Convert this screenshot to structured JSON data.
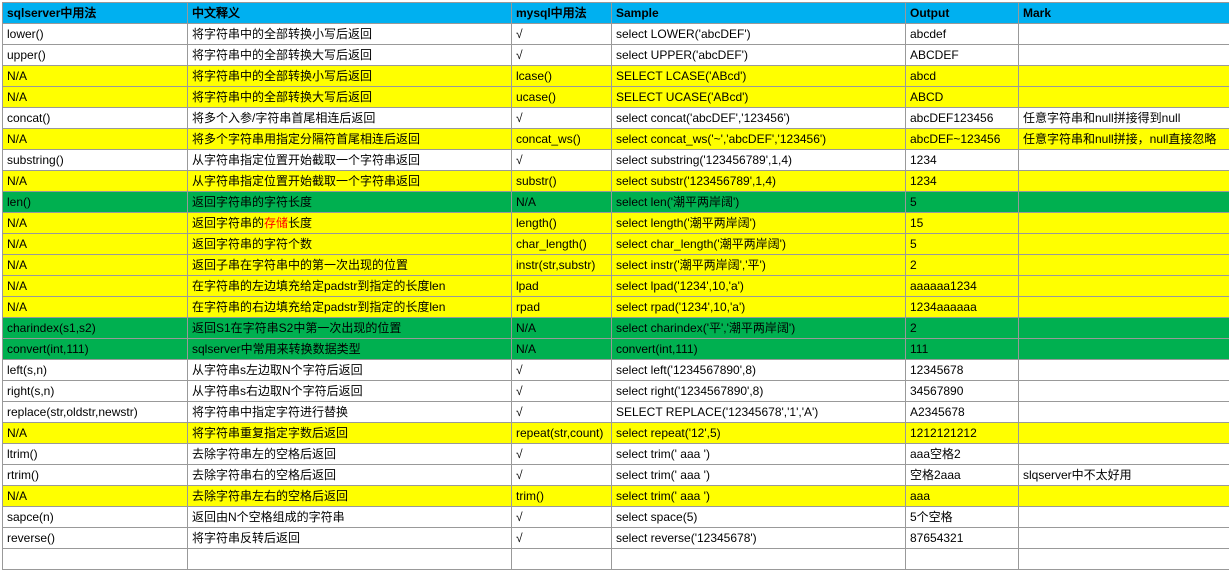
{
  "headers": [
    "sqlserver中用法",
    "中文释义",
    "mysql中用法",
    "Sample",
    "Output",
    "Mark"
  ],
  "rows": [
    {
      "c": "",
      "d": [
        "lower()",
        "将字符串中的全部转换小写后返回",
        "√",
        "select LOWER('abcDEF')",
        "abcdef",
        ""
      ]
    },
    {
      "c": "",
      "d": [
        "upper()",
        "将字符串中的全部转换大写后返回",
        "√",
        "select UPPER('abcDEF')",
        "ABCDEF",
        ""
      ]
    },
    {
      "c": "yellow",
      "d": [
        "N/A",
        "将字符串中的全部转换小写后返回",
        "lcase()",
        "SELECT LCASE('ABcd')",
        "abcd",
        ""
      ]
    },
    {
      "c": "yellow",
      "d": [
        "N/A",
        "将字符串中的全部转换大写后返回",
        "ucase()",
        "SELECT UCASE('ABcd')",
        "ABCD",
        ""
      ]
    },
    {
      "c": "",
      "d": [
        "concat()",
        "将多个入参/字符串首尾相连后返回",
        "√",
        "select concat('abcDEF','123456')",
        "abcDEF123456",
        "任意字符串和null拼接得到null"
      ]
    },
    {
      "c": "yellow",
      "d": [
        "N/A",
        "将多个字符串用指定分隔符首尾相连后返回",
        "concat_ws()",
        "select concat_ws('~','abcDEF','123456')",
        "abcDEF~123456",
        "任意字符串和null拼接，null直接忽略"
      ]
    },
    {
      "c": "",
      "d": [
        "substring()",
        "从字符串指定位置开始截取一个字符串返回",
        "√",
        "select substring('123456789',1,4)",
        "1234",
        ""
      ]
    },
    {
      "c": "yellow",
      "d": [
        "N/A",
        "从字符串指定位置开始截取一个字符串返回",
        "substr()",
        "select substr('123456789',1,4)",
        "1234",
        ""
      ]
    },
    {
      "c": "green",
      "d": [
        "len()",
        "返回字符串的字符长度",
        "N/A",
        "select len('潮平两岸阔')",
        "5",
        ""
      ]
    },
    {
      "c": "yellow",
      "d": [
        "N/A",
        {
          "html": "返回字符串的<span class='red'>存储</span>长度"
        },
        "length()",
        "select length('潮平两岸阔')",
        "15",
        ""
      ]
    },
    {
      "c": "yellow",
      "d": [
        "N/A",
        "返回字符串的字符个数",
        "char_length()",
        "select char_length('潮平两岸阔')",
        "5",
        ""
      ]
    },
    {
      "c": "yellow",
      "d": [
        "N/A",
        "返回子串在字符串中的第一次出现的位置",
        "instr(str,substr)",
        "select instr('潮平两岸阔','平')",
        "2",
        ""
      ]
    },
    {
      "c": "yellow",
      "d": [
        "N/A",
        "在字符串的左边填充给定padstr到指定的长度len",
        "lpad",
        "select lpad('1234',10,'a')",
        "aaaaaa1234",
        ""
      ]
    },
    {
      "c": "yellow",
      "d": [
        "N/A",
        "在字符串的右边填充给定padstr到指定的长度len",
        "rpad",
        "select rpad('1234',10,'a')",
        "1234aaaaaa",
        ""
      ]
    },
    {
      "c": "green",
      "d": [
        "charindex(s1,s2)",
        "返回S1在字符串S2中第一次出现的位置",
        "N/A",
        "select charindex('平','潮平两岸阔')",
        "2",
        ""
      ]
    },
    {
      "c": "green",
      "d": [
        "convert(int,111)",
        "sqlserver中常用来转换数据类型",
        "N/A",
        "convert(int,111)",
        "111",
        ""
      ]
    },
    {
      "c": "",
      "d": [
        "left(s,n)",
        "从字符串s左边取N个字符后返回",
        "√",
        "select left('1234567890',8)",
        "12345678",
        ""
      ]
    },
    {
      "c": "",
      "d": [
        "right(s,n)",
        "从字符串s右边取N个字符后返回",
        "√",
        "select right('1234567890',8)",
        "34567890",
        ""
      ]
    },
    {
      "c": "",
      "d": [
        "replace(str,oldstr,newstr)",
        "将字符串中指定字符进行替换",
        "√",
        "SELECT REPLACE('12345678','1','A')",
        "A2345678",
        ""
      ]
    },
    {
      "c": "yellow",
      "d": [
        "N/A",
        "将字符串重复指定字数后返回",
        "repeat(str,count)",
        "select repeat('12',5)",
        "1212121212",
        ""
      ]
    },
    {
      "c": "",
      "d": [
        "ltrim()",
        "去除字符串左的空格后返回",
        "√",
        "select trim('   aaa   ')",
        "aaa空格2",
        ""
      ]
    },
    {
      "c": "",
      "d": [
        "rtrim()",
        "去除字符串右的空格后返回",
        "√",
        "select trim('   aaa   ')",
        "空格2aaa",
        "slqserver中不太好用"
      ]
    },
    {
      "c": "yellow",
      "d": [
        "N/A",
        "去除字符串左右的空格后返回",
        "trim()",
        "select trim('   aaa   ')",
        "aaa",
        ""
      ]
    },
    {
      "c": "",
      "d": [
        "sapce(n)",
        "返回由N个空格组成的字符串",
        "√",
        "select space(5)",
        "5个空格",
        ""
      ]
    },
    {
      "c": "",
      "d": [
        "reverse()",
        "将字符串反转后返回",
        "√",
        "select reverse('12345678')",
        "87654321",
        ""
      ]
    },
    {
      "c": "",
      "d": [
        "",
        "",
        "",
        "",
        "",
        ""
      ]
    }
  ]
}
